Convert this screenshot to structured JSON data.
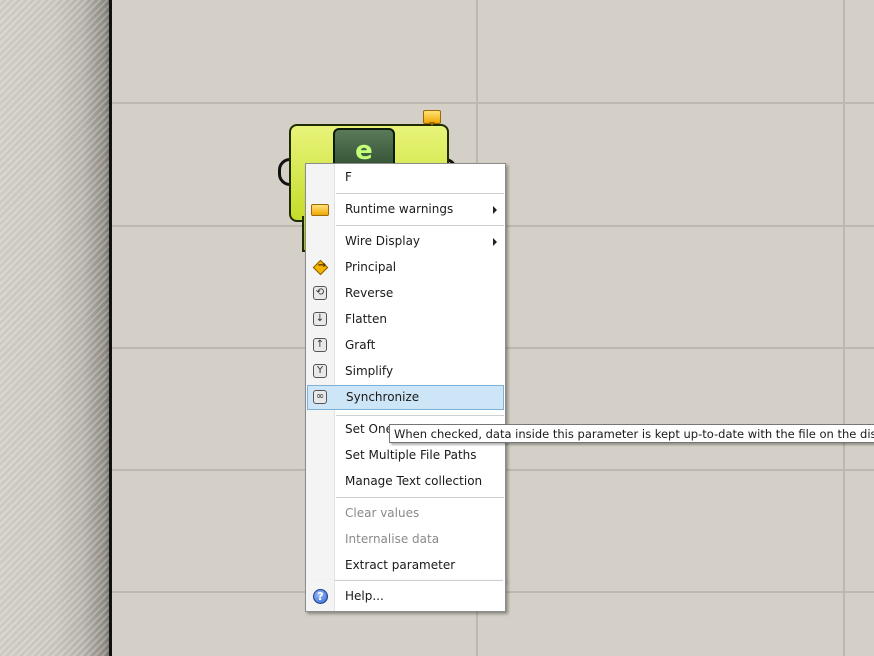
{
  "component": {
    "icon_glyph": "e",
    "fill_color": "#d6e83a",
    "warning_icon": "warning-balloon-icon"
  },
  "menu": {
    "title": "F",
    "items": [
      {
        "label": "Runtime warnings",
        "icon": "warning-balloon-icon",
        "submenu": true,
        "enabled": true
      },
      {
        "label": "Wire Display",
        "icon": "",
        "submenu": true,
        "enabled": true
      },
      {
        "label": "Principal",
        "icon": "principal-icon",
        "submenu": false,
        "enabled": true
      },
      {
        "label": "Reverse",
        "icon": "reverse-icon",
        "submenu": false,
        "enabled": true
      },
      {
        "label": "Flatten",
        "icon": "flatten-icon",
        "submenu": false,
        "enabled": true
      },
      {
        "label": "Graft",
        "icon": "graft-icon",
        "submenu": false,
        "enabled": true
      },
      {
        "label": "Simplify",
        "icon": "simplify-icon",
        "submenu": false,
        "enabled": true
      },
      {
        "label": "Synchronize",
        "icon": "synchronize-icon",
        "submenu": false,
        "enabled": true,
        "highlighted": true
      },
      {
        "label": "Set One",
        "icon": "",
        "submenu": false,
        "enabled": true
      },
      {
        "label": "Set Multiple File Paths",
        "icon": "",
        "submenu": false,
        "enabled": true
      },
      {
        "label": "Manage Text collection",
        "icon": "",
        "submenu": false,
        "enabled": true
      },
      {
        "label": "Clear values",
        "icon": "",
        "submenu": false,
        "enabled": false
      },
      {
        "label": "Internalise data",
        "icon": "",
        "submenu": false,
        "enabled": false
      },
      {
        "label": "Extract parameter",
        "icon": "",
        "submenu": false,
        "enabled": true
      },
      {
        "label": "Help...",
        "icon": "help-icon",
        "submenu": false,
        "enabled": true
      }
    ]
  },
  "tooltip": {
    "text": "When checked, data inside this parameter is kept up-to-date with the file on the disk"
  },
  "colors": {
    "canvas": "#d4d0c8",
    "highlight": "#cde6f7",
    "highlight_border": "#7fb1d6",
    "disabled_text": "#8a8a8a"
  }
}
